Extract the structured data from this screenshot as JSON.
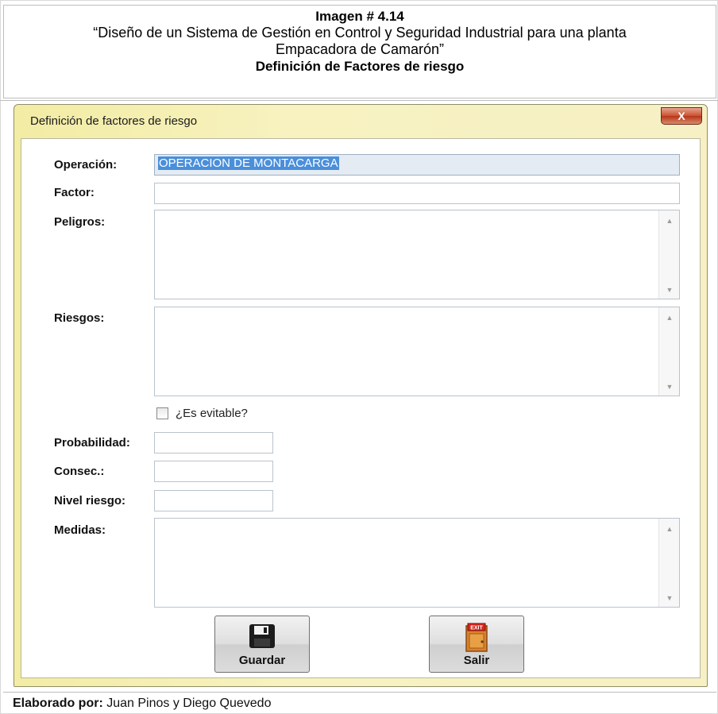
{
  "caption": {
    "line1": "Imagen # 4.14",
    "line2": "“Diseño de un Sistema de Gestión en Control y Seguridad Industrial para una planta",
    "line3": "Empacadora de Camarón”",
    "line4": "Definición de Factores de riesgo"
  },
  "window": {
    "title": "Definición de factores de riesgo",
    "close_label": "X"
  },
  "form": {
    "operacion_label": "Operación:",
    "operacion_value": "OPERACION DE MONTACARGA",
    "factor_label": "Factor:",
    "factor_value": "",
    "peligros_label": "Peligros:",
    "riesgos_label": "Riesgos:",
    "evitable_label": "¿Es evitable?",
    "probabilidad_label": "Probabilidad:",
    "consec_label": "Consec.:",
    "nivel_label": "Nivel riesgo:",
    "medidas_label": "Medidas:"
  },
  "buttons": {
    "save_label": "Guardar",
    "exit_label": "Salir",
    "exit_icon_text": "EXIT"
  },
  "footer": {
    "prefix": "Elaborado por:",
    "authors": "Juan Pinos y Diego Quevedo"
  },
  "colors": {
    "window_frame": "#f6f0c4",
    "selection": "#4a8fdb",
    "close_button": "#c9502f"
  }
}
